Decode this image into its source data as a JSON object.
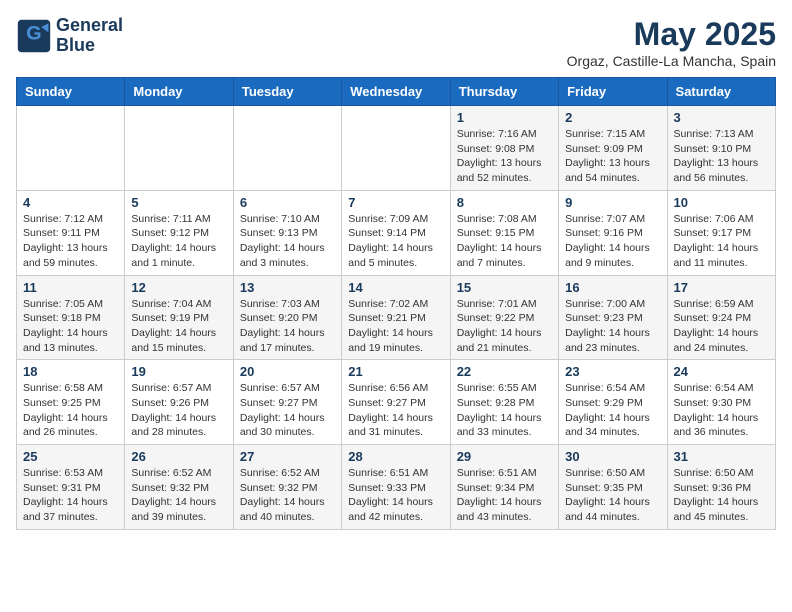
{
  "logo": {
    "line1": "General",
    "line2": "Blue"
  },
  "title": "May 2025",
  "subtitle": "Orgaz, Castille-La Mancha, Spain",
  "days_of_week": [
    "Sunday",
    "Monday",
    "Tuesday",
    "Wednesday",
    "Thursday",
    "Friday",
    "Saturday"
  ],
  "weeks": [
    [
      {
        "day": "",
        "sunrise": "",
        "sunset": "",
        "daylight": ""
      },
      {
        "day": "",
        "sunrise": "",
        "sunset": "",
        "daylight": ""
      },
      {
        "day": "",
        "sunrise": "",
        "sunset": "",
        "daylight": ""
      },
      {
        "day": "",
        "sunrise": "",
        "sunset": "",
        "daylight": ""
      },
      {
        "day": "1",
        "sunrise": "Sunrise: 7:16 AM",
        "sunset": "Sunset: 9:08 PM",
        "daylight": "Daylight: 13 hours and 52 minutes."
      },
      {
        "day": "2",
        "sunrise": "Sunrise: 7:15 AM",
        "sunset": "Sunset: 9:09 PM",
        "daylight": "Daylight: 13 hours and 54 minutes."
      },
      {
        "day": "3",
        "sunrise": "Sunrise: 7:13 AM",
        "sunset": "Sunset: 9:10 PM",
        "daylight": "Daylight: 13 hours and 56 minutes."
      }
    ],
    [
      {
        "day": "4",
        "sunrise": "Sunrise: 7:12 AM",
        "sunset": "Sunset: 9:11 PM",
        "daylight": "Daylight: 13 hours and 59 minutes."
      },
      {
        "day": "5",
        "sunrise": "Sunrise: 7:11 AM",
        "sunset": "Sunset: 9:12 PM",
        "daylight": "Daylight: 14 hours and 1 minute."
      },
      {
        "day": "6",
        "sunrise": "Sunrise: 7:10 AM",
        "sunset": "Sunset: 9:13 PM",
        "daylight": "Daylight: 14 hours and 3 minutes."
      },
      {
        "day": "7",
        "sunrise": "Sunrise: 7:09 AM",
        "sunset": "Sunset: 9:14 PM",
        "daylight": "Daylight: 14 hours and 5 minutes."
      },
      {
        "day": "8",
        "sunrise": "Sunrise: 7:08 AM",
        "sunset": "Sunset: 9:15 PM",
        "daylight": "Daylight: 14 hours and 7 minutes."
      },
      {
        "day": "9",
        "sunrise": "Sunrise: 7:07 AM",
        "sunset": "Sunset: 9:16 PM",
        "daylight": "Daylight: 14 hours and 9 minutes."
      },
      {
        "day": "10",
        "sunrise": "Sunrise: 7:06 AM",
        "sunset": "Sunset: 9:17 PM",
        "daylight": "Daylight: 14 hours and 11 minutes."
      }
    ],
    [
      {
        "day": "11",
        "sunrise": "Sunrise: 7:05 AM",
        "sunset": "Sunset: 9:18 PM",
        "daylight": "Daylight: 14 hours and 13 minutes."
      },
      {
        "day": "12",
        "sunrise": "Sunrise: 7:04 AM",
        "sunset": "Sunset: 9:19 PM",
        "daylight": "Daylight: 14 hours and 15 minutes."
      },
      {
        "day": "13",
        "sunrise": "Sunrise: 7:03 AM",
        "sunset": "Sunset: 9:20 PM",
        "daylight": "Daylight: 14 hours and 17 minutes."
      },
      {
        "day": "14",
        "sunrise": "Sunrise: 7:02 AM",
        "sunset": "Sunset: 9:21 PM",
        "daylight": "Daylight: 14 hours and 19 minutes."
      },
      {
        "day": "15",
        "sunrise": "Sunrise: 7:01 AM",
        "sunset": "Sunset: 9:22 PM",
        "daylight": "Daylight: 14 hours and 21 minutes."
      },
      {
        "day": "16",
        "sunrise": "Sunrise: 7:00 AM",
        "sunset": "Sunset: 9:23 PM",
        "daylight": "Daylight: 14 hours and 23 minutes."
      },
      {
        "day": "17",
        "sunrise": "Sunrise: 6:59 AM",
        "sunset": "Sunset: 9:24 PM",
        "daylight": "Daylight: 14 hours and 24 minutes."
      }
    ],
    [
      {
        "day": "18",
        "sunrise": "Sunrise: 6:58 AM",
        "sunset": "Sunset: 9:25 PM",
        "daylight": "Daylight: 14 hours and 26 minutes."
      },
      {
        "day": "19",
        "sunrise": "Sunrise: 6:57 AM",
        "sunset": "Sunset: 9:26 PM",
        "daylight": "Daylight: 14 hours and 28 minutes."
      },
      {
        "day": "20",
        "sunrise": "Sunrise: 6:57 AM",
        "sunset": "Sunset: 9:27 PM",
        "daylight": "Daylight: 14 hours and 30 minutes."
      },
      {
        "day": "21",
        "sunrise": "Sunrise: 6:56 AM",
        "sunset": "Sunset: 9:27 PM",
        "daylight": "Daylight: 14 hours and 31 minutes."
      },
      {
        "day": "22",
        "sunrise": "Sunrise: 6:55 AM",
        "sunset": "Sunset: 9:28 PM",
        "daylight": "Daylight: 14 hours and 33 minutes."
      },
      {
        "day": "23",
        "sunrise": "Sunrise: 6:54 AM",
        "sunset": "Sunset: 9:29 PM",
        "daylight": "Daylight: 14 hours and 34 minutes."
      },
      {
        "day": "24",
        "sunrise": "Sunrise: 6:54 AM",
        "sunset": "Sunset: 9:30 PM",
        "daylight": "Daylight: 14 hours and 36 minutes."
      }
    ],
    [
      {
        "day": "25",
        "sunrise": "Sunrise: 6:53 AM",
        "sunset": "Sunset: 9:31 PM",
        "daylight": "Daylight: 14 hours and 37 minutes."
      },
      {
        "day": "26",
        "sunrise": "Sunrise: 6:52 AM",
        "sunset": "Sunset: 9:32 PM",
        "daylight": "Daylight: 14 hours and 39 minutes."
      },
      {
        "day": "27",
        "sunrise": "Sunrise: 6:52 AM",
        "sunset": "Sunset: 9:32 PM",
        "daylight": "Daylight: 14 hours and 40 minutes."
      },
      {
        "day": "28",
        "sunrise": "Sunrise: 6:51 AM",
        "sunset": "Sunset: 9:33 PM",
        "daylight": "Daylight: 14 hours and 42 minutes."
      },
      {
        "day": "29",
        "sunrise": "Sunrise: 6:51 AM",
        "sunset": "Sunset: 9:34 PM",
        "daylight": "Daylight: 14 hours and 43 minutes."
      },
      {
        "day": "30",
        "sunrise": "Sunrise: 6:50 AM",
        "sunset": "Sunset: 9:35 PM",
        "daylight": "Daylight: 14 hours and 44 minutes."
      },
      {
        "day": "31",
        "sunrise": "Sunrise: 6:50 AM",
        "sunset": "Sunset: 9:36 PM",
        "daylight": "Daylight: 14 hours and 45 minutes."
      }
    ]
  ]
}
